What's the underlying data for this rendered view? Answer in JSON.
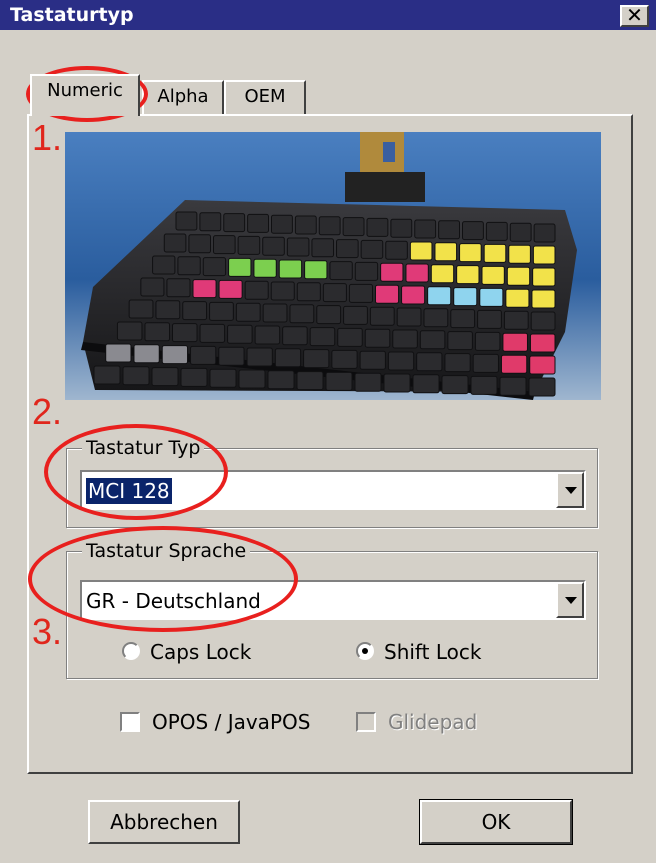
{
  "window": {
    "title": "Tastaturtyp",
    "close_symbol": "✕"
  },
  "tabs": [
    {
      "label": "Numeric",
      "active": true
    },
    {
      "label": "Alpha",
      "active": false
    },
    {
      "label": "OEM",
      "active": false
    }
  ],
  "keyboard_type": {
    "group_label": "Tastatur Typ",
    "value": "MCI 128"
  },
  "keyboard_language": {
    "group_label": "Tastatur Sprache",
    "value": "GR - Deutschland",
    "caps_lock_label": "Caps Lock",
    "shift_lock_label": "Shift Lock",
    "selected": "Shift Lock"
  },
  "options": {
    "opos_label": "OPOS / JavaPOS",
    "opos_checked": false,
    "glidepad_label": "Glidepad",
    "glidepad_enabled": false
  },
  "buttons": {
    "cancel": "Abbrechen",
    "ok": "OK"
  },
  "annotations": {
    "step1": "1.",
    "step2": "2.",
    "step3": "3.",
    "color": "#e8201e"
  }
}
